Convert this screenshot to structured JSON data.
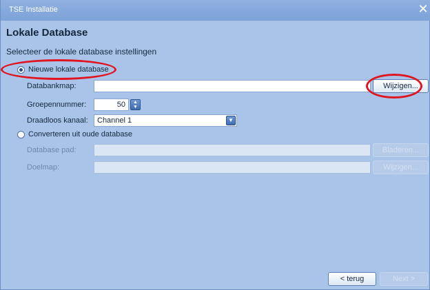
{
  "window": {
    "title": "TSE Installatie",
    "close_glyph": "✕"
  },
  "page": {
    "heading": "Lokale Database",
    "subheading": "Selecteer de lokale database instellingen"
  },
  "new_db": {
    "option_label": "Nieuwe lokale database",
    "selected": true,
    "folder_label": "Databankmap:",
    "folder_value": "",
    "change_button": "Wijzigen...",
    "group_label": "Groepennummer:",
    "group_value": "50",
    "channel_label": "Draadloos kanaal:",
    "channel_value": "Channel 1"
  },
  "convert_db": {
    "option_label": "Converteren uit oude database",
    "selected": false,
    "path_label": "Database pad:",
    "path_value": "",
    "browse_button": "Bladeren...",
    "target_label": "Doelmap:",
    "target_value": "",
    "change_button": "Wijzigen..."
  },
  "footer": {
    "back_button": "< terug",
    "next_button": "Next >"
  },
  "icons": {
    "close": "close-icon",
    "spin": "spin-arrows-icon",
    "dropdown": "chevron-down-icon"
  },
  "colors": {
    "background": "#a9c4e8",
    "titlebar": "#7ea3da",
    "annotation": "#e0151f"
  }
}
